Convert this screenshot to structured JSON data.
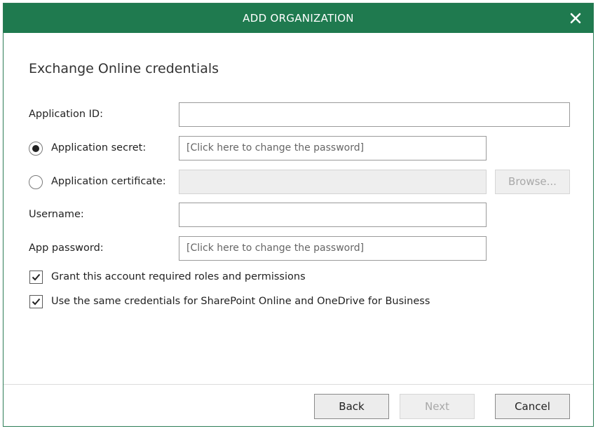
{
  "window": {
    "title": "ADD ORGANIZATION",
    "close_icon": "close-icon"
  },
  "section": {
    "title": "Exchange Online credentials"
  },
  "form": {
    "application_id": {
      "label": "Application ID:",
      "value": ""
    },
    "application_secret": {
      "label": "Application secret:",
      "value": "[Click here to change the password]",
      "selected": true
    },
    "application_certificate": {
      "label": "Application certificate:",
      "value": "",
      "selected": false,
      "browse_label": "Browse..."
    },
    "username": {
      "label": "Username:",
      "value": ""
    },
    "app_password": {
      "label": "App password:",
      "value": "[Click here to change the password]"
    },
    "grant_permissions": {
      "label": "Grant this account required roles and permissions",
      "checked": true
    },
    "same_credentials": {
      "label": "Use the same credentials for SharePoint Online and OneDrive for Business",
      "checked": true
    }
  },
  "footer": {
    "back_label": "Back",
    "next_label": "Next",
    "cancel_label": "Cancel"
  },
  "colors": {
    "titlebar": "#1f7a4f",
    "text": "#222222",
    "disabled_text": "#a8a8a8"
  }
}
